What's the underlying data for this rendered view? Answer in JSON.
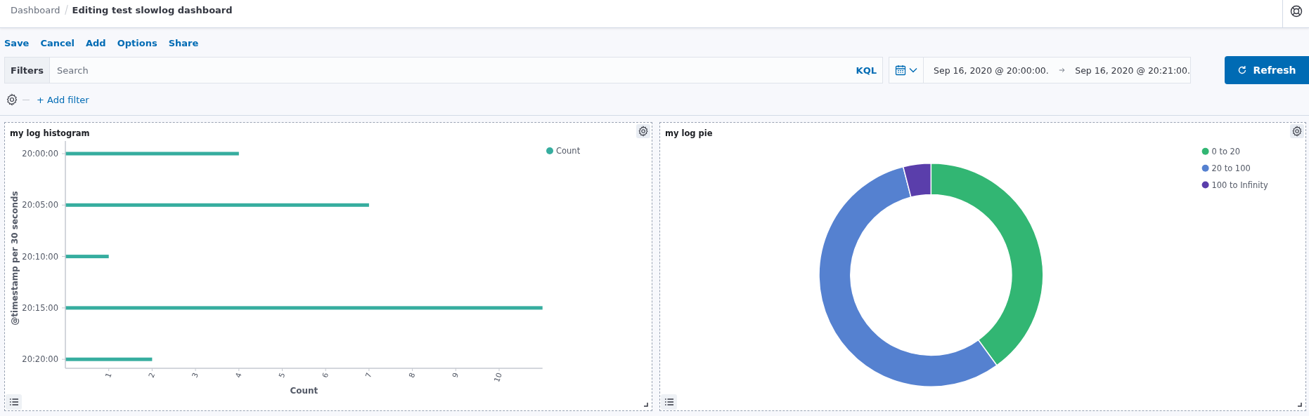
{
  "breadcrumbs": [
    {
      "label": "Dashboard",
      "current": false
    },
    {
      "label": "Editing test slowlog dashboard",
      "current": true
    }
  ],
  "menu": [
    "Save",
    "Cancel",
    "Add",
    "Options",
    "Share"
  ],
  "query": {
    "filters_label": "Filters",
    "placeholder": "Search",
    "language": "KQL"
  },
  "time": {
    "start": "Sep 16, 2020 @ 20:00:00.",
    "end": "Sep 16, 2020 @ 20:21:00.",
    "refresh": "Refresh"
  },
  "add_filter": "+ Add filter",
  "panels": [
    {
      "title": "my log histogram",
      "chart_data": {
        "type": "bar",
        "orientation": "horizontal",
        "xlabel": "Count",
        "ylabel": "@timestamp per 30 seconds",
        "categories": [
          "20:00:00",
          "20:05:00",
          "20:10:00",
          "20:15:00",
          "20:20:00"
        ],
        "xticks": [
          1,
          2,
          3,
          4,
          5,
          6,
          7,
          8,
          9,
          10
        ],
        "xlim": [
          0,
          11
        ],
        "legend": "right",
        "series": [
          {
            "name": "Count",
            "color": "#36ad9f",
            "values": [
              4,
              7,
              1,
              11,
              2
            ]
          }
        ]
      }
    },
    {
      "title": "my log pie",
      "chart_data": {
        "type": "donut",
        "categories": [
          "0 to 20",
          "20 to 100",
          "100 to Infinity"
        ],
        "values": [
          40,
          56,
          4
        ],
        "legend": "right",
        "colors": [
          "#32b673",
          "#5581d0",
          "#5a3eab"
        ]
      }
    }
  ]
}
